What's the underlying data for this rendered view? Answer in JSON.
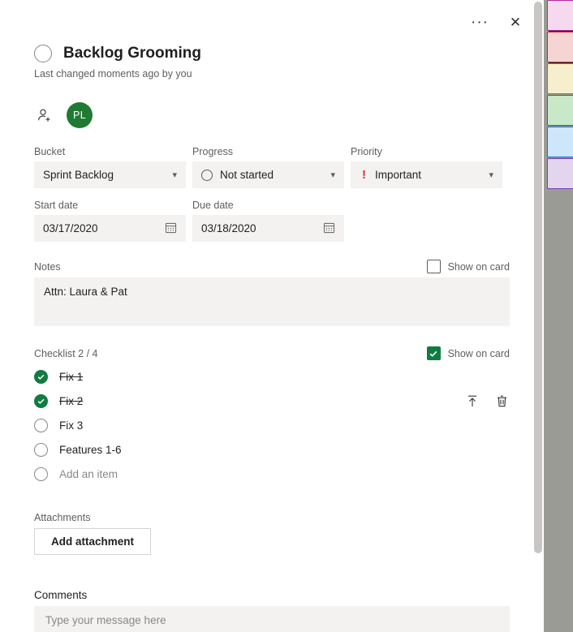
{
  "colors": {
    "accent_green": "#107c41",
    "priority_red": "#d13438",
    "field_background": "#f3f2f1",
    "board_background": "#9b9b96",
    "board_dark_band": "#1e2a38"
  },
  "topbar": {
    "more_options_label": "···",
    "close_label": "✕"
  },
  "task": {
    "title": "Backlog Grooming",
    "subtitle": "Last changed moments ago by you",
    "completed": false
  },
  "assignees": {
    "add_icon": "add-person-icon",
    "people": [
      {
        "initials": "PL",
        "color": "#217a33"
      }
    ]
  },
  "fields": {
    "bucket": {
      "label": "Bucket",
      "value": "Sprint Backlog"
    },
    "progress": {
      "label": "Progress",
      "value": "Not started"
    },
    "priority": {
      "label": "Priority",
      "value": "Important",
      "mark": "!"
    },
    "start_date": {
      "label": "Start date",
      "value": "03/17/2020"
    },
    "due_date": {
      "label": "Due date",
      "value": "03/18/2020"
    }
  },
  "notes": {
    "label": "Notes",
    "value": "Attn: Laura & Pat",
    "show_on_card_label": "Show on card",
    "show_on_card_checked": false
  },
  "checklist": {
    "label": "Checklist 2 / 4",
    "show_on_card_label": "Show on card",
    "show_on_card_checked": true,
    "items": [
      {
        "text": "Fix 1",
        "done": true,
        "show_actions": false
      },
      {
        "text": "Fix 2",
        "done": true,
        "show_actions": true
      },
      {
        "text": "Fix 3",
        "done": false,
        "show_actions": false
      },
      {
        "text": "Features 1-6",
        "done": false,
        "show_actions": false
      }
    ],
    "add_item_placeholder": "Add an item",
    "promote_action_label": "promote-to-task-icon",
    "delete_action_label": "delete-item-icon"
  },
  "attachments": {
    "label": "Attachments",
    "add_button_label": "Add attachment"
  },
  "comments": {
    "label": "Comments",
    "placeholder": "Type your message here"
  },
  "board_swatches": [
    {
      "fill": "#f7d9ef",
      "border": "#b4289b"
    },
    {
      "fill": "#f7d4d4",
      "border": "#c42b2b"
    },
    {
      "fill": "#f7eecd",
      "border": "#9c7b08"
    },
    {
      "fill": "#c8e8c8",
      "border": "#1d8a1d"
    },
    {
      "fill": "#cde6fa",
      "border": "#1a72c4"
    },
    {
      "fill": "#e3d5ee",
      "border": "#7b3fb5"
    }
  ]
}
